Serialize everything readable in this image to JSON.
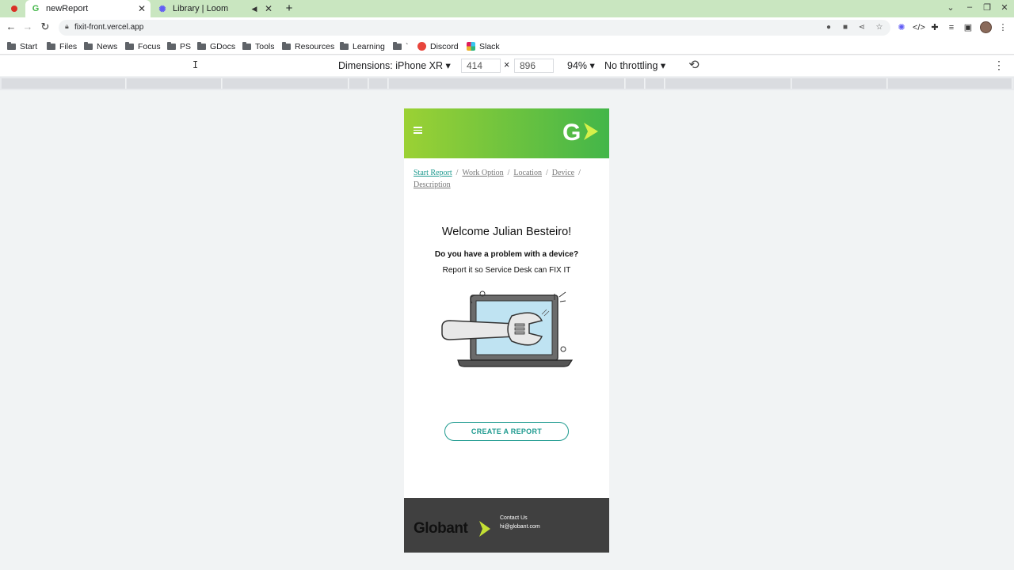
{
  "browser": {
    "tabs": [
      {
        "title": "newReport",
        "favicon": "G"
      },
      {
        "title": "Library | Loom"
      }
    ],
    "url": "fixit-front.vercel.app",
    "bookmarks": [
      "Start",
      "Files",
      "News",
      "Focus",
      "PS",
      "GDocs",
      "Tools",
      "Resources",
      "Learning",
      "`",
      "Discord",
      "Slack"
    ]
  },
  "devtools": {
    "dimensions_label": "Dimensions: iPhone XR ▾",
    "width": "414",
    "times": "×",
    "height": "896",
    "zoom": "94% ▾",
    "throttling": "No throttling ▾"
  },
  "app": {
    "logo_letter": "G",
    "breadcrumb": [
      "Start Report",
      "Work Option",
      "Location",
      "Device",
      "Description"
    ],
    "breadcrumb_sep": "/",
    "welcome": "Welcome Julian Besteiro!",
    "question": "Do you have a problem with a device?",
    "report_line": "Report it so Service Desk can FIX IT",
    "create_button": "CREATE A REPORT",
    "footer": {
      "brand": "Globant",
      "contact_title": "Contact Us",
      "contact_email": "hi@globant.com"
    }
  },
  "colors": {
    "accent": "#1e9a8f",
    "header_start": "#9bd134",
    "header_end": "#43b649",
    "footer_bg": "#404040"
  }
}
